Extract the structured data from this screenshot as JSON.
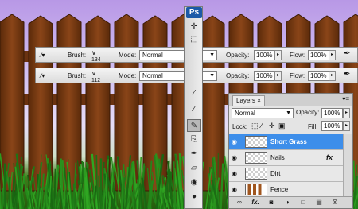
{
  "app": {
    "logo": "Ps"
  },
  "options_bars": [
    {
      "brush_label": "Brush:",
      "brush_size": "134",
      "mode_label": "Mode:",
      "mode_value": "Normal",
      "opacity_label": "Opacity:",
      "opacity_value": "100%",
      "flow_label": "Flow:",
      "flow_value": "100%"
    },
    {
      "brush_label": "Brush:",
      "brush_size": "112",
      "mode_label": "Mode:",
      "mode_value": "Normal",
      "opacity_label": "Opacity:",
      "opacity_value": "100%",
      "flow_label": "Flow:",
      "flow_value": "100%"
    }
  ],
  "toolbox": {
    "tools": [
      "move-icon",
      "marquee-icon",
      "healing-brush-icon",
      "brush-icon",
      "clone-stamp-icon",
      "history-brush-icon",
      "eraser-icon",
      "paint-bucket-icon",
      "dodge-icon"
    ],
    "active_tool": "brush-icon"
  },
  "layers_panel": {
    "tab_label": "Layers",
    "close_glyph": "×",
    "blend_mode": "Normal",
    "opacity_label": "Opacity:",
    "opacity_value": "100%",
    "lock_label": "Lock:",
    "fill_label": "Fill:",
    "fill_value": "100%",
    "layers": [
      {
        "name": "Short Grass",
        "selected": true,
        "fx": ""
      },
      {
        "name": "Nails",
        "selected": false,
        "fx": "fx"
      },
      {
        "name": "Dirt",
        "selected": false,
        "fx": ""
      },
      {
        "name": "Fence",
        "selected": false,
        "fx": ""
      }
    ],
    "bottom_icons": [
      "link-icon",
      "fx-icon",
      "mask-icon",
      "adjustment-icon",
      "group-icon",
      "new-layer-icon",
      "trash-icon"
    ]
  },
  "colors": {
    "selected_layer": "#3d8eea",
    "fence_wood": "#7a3b12",
    "grass": "#2f7a12",
    "sky": "#c4aef0"
  }
}
